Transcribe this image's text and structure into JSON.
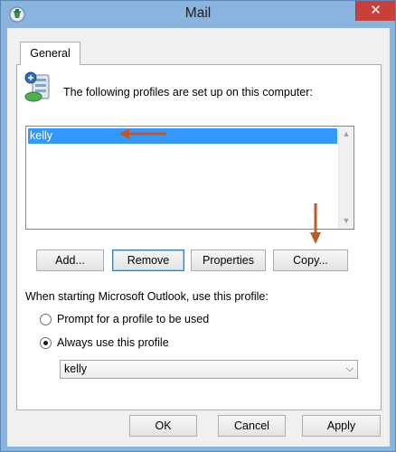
{
  "window": {
    "title": "Mail",
    "close_glyph": "✕"
  },
  "tabs": [
    {
      "label": "General"
    }
  ],
  "general": {
    "intro_text": "The following profiles are set up on this computer:",
    "profiles": [
      "kelly"
    ],
    "buttons": {
      "add": "Add...",
      "remove": "Remove",
      "properties": "Properties",
      "copy": "Copy..."
    },
    "startup_label": "When starting Microsoft Outlook, use this profile:",
    "radio_prompt": "Prompt for a profile to be used",
    "radio_always": "Always use this profile",
    "selected_radio": "always",
    "selected_profile": "kelly"
  },
  "footer": {
    "ok": "OK",
    "cancel": "Cancel",
    "apply": "Apply"
  },
  "icons": {
    "app": "mail-app-icon",
    "profiles": "profiles-server-icon",
    "scroll_up": "scroll-up-icon",
    "scroll_down": "scroll-down-icon",
    "dropdown": "chevron-down-icon"
  },
  "colors": {
    "selection": "#3399ff",
    "annotation_arrow": "#c0582a",
    "close_button": "#c7403a",
    "window_frame": "#8ab3de"
  }
}
